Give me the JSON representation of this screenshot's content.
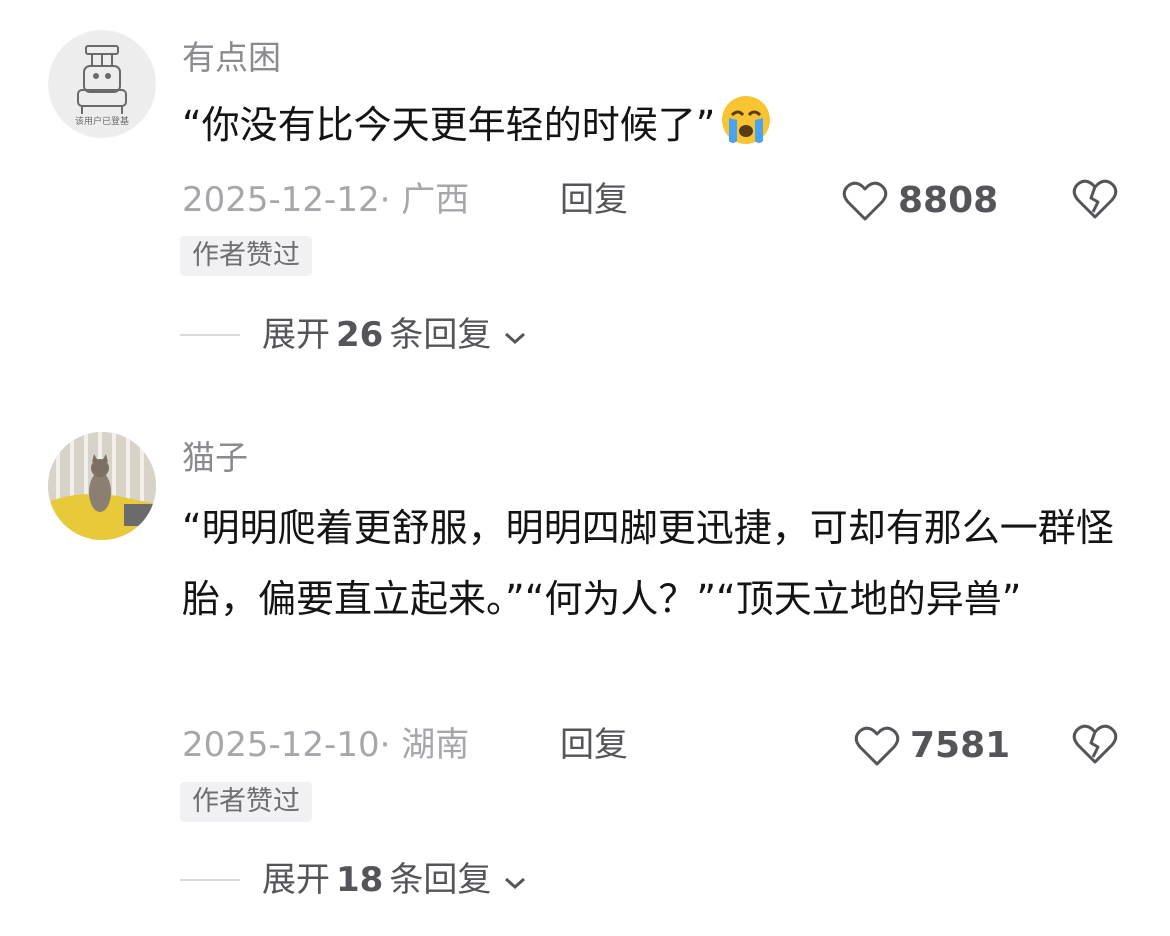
{
  "comments": [
    {
      "username": "有点困",
      "avatar_label": "该用户已登基",
      "text": "“你没有比今天更年轻的时候了”",
      "emoji": "loudly-crying-face",
      "meta": "2025-12-12· 广西",
      "reply_label": "回复",
      "likes": "8808",
      "badge": "作者赞过",
      "expand_prefix": "展开",
      "expand_count": "26",
      "expand_suffix": "条回复"
    },
    {
      "username": "猫子",
      "text": "“明明爬着更舒服，明明四脚更迅捷，可却有那么一群怪胎，偏要直立起来。”“何为人？”“顶天立地的异兽”",
      "meta": "2025-12-10· 湖南",
      "reply_label": "回复",
      "likes": "7581",
      "badge": "作者赞过",
      "expand_prefix": "展开",
      "expand_count": "18",
      "expand_suffix": "条回复"
    }
  ],
  "colors": {
    "text": "#141414",
    "secondary": "#a6a6ab",
    "action": "#555559",
    "badge_bg": "#f1f1f3"
  },
  "icons": {
    "like": "heart-outline-icon",
    "dislike": "broken-heart-icon",
    "expand": "chevron-down-icon"
  }
}
